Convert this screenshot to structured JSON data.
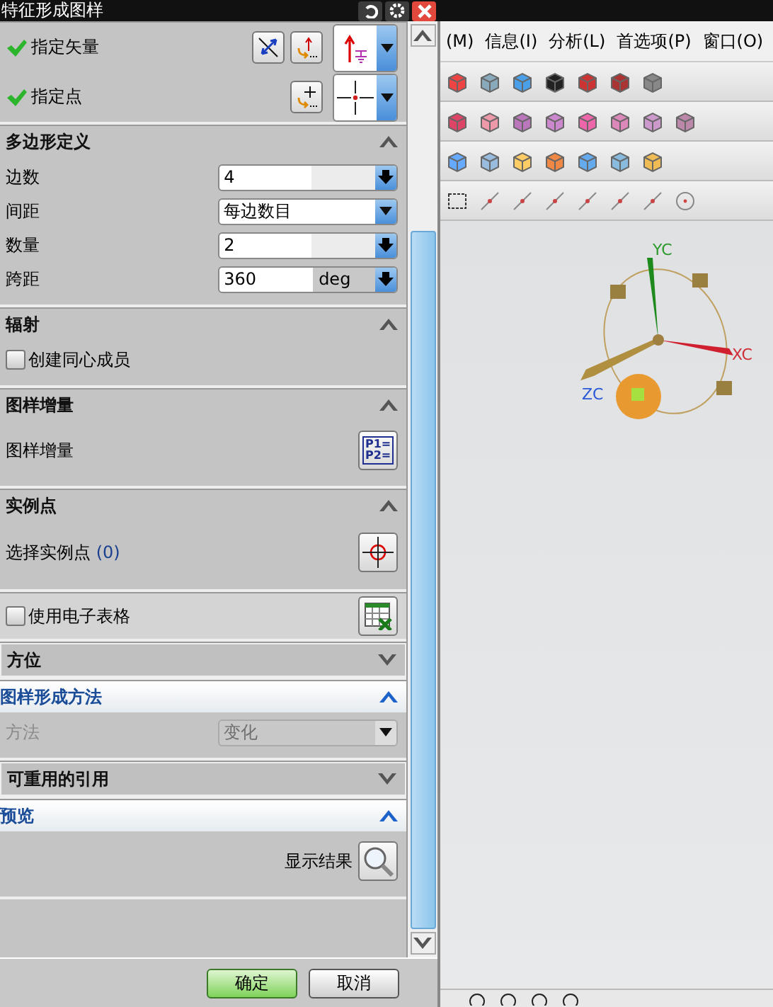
{
  "title_bar": {
    "title": "特征形成图样"
  },
  "menu_bar": {
    "items": [
      "(M)",
      "信息(I)",
      "分析(L)",
      "首选项(P)",
      "窗口(O)"
    ]
  },
  "dialog": {
    "sections": [
      {
        "rows": [
          {
            "kind": "vector",
            "label": "指定矢量",
            "complete": true
          },
          {
            "kind": "point",
            "label": "指定点",
            "complete": true
          }
        ]
      },
      {
        "title": "多边形定义",
        "expanded": true,
        "highlighted": false,
        "rows": [
          {
            "kind": "spin",
            "label": "边数",
            "value": "4"
          },
          {
            "kind": "dropdown",
            "label": "间距",
            "value": "每边数目",
            "disabled": false
          },
          {
            "kind": "spin",
            "label": "数量",
            "value": "2"
          },
          {
            "kind": "spin",
            "label": "跨距",
            "value": "360",
            "unit": "deg"
          }
        ]
      },
      {
        "title": "辐射",
        "expanded": true,
        "highlighted": false,
        "rows": [
          {
            "kind": "checkbox",
            "label": "创建同心成员",
            "checked": false
          }
        ]
      },
      {
        "title": "图样增量",
        "expanded": true,
        "highlighted": false,
        "rows": [
          {
            "kind": "increment",
            "label": "图样增量",
            "icon_text": [
              "P1=",
              "P2="
            ]
          }
        ]
      },
      {
        "title": "实例点",
        "expanded": true,
        "highlighted": false,
        "rows": [
          {
            "kind": "select",
            "label": "选择实例点",
            "count": "(0)"
          }
        ]
      },
      {
        "rows": [
          {
            "kind": "spreadsheet",
            "label": "使用电子表格",
            "checked": false
          }
        ]
      },
      {
        "title": "方位",
        "expanded": false,
        "highlighted": false
      },
      {
        "title": "图样形成方法",
        "expanded": true,
        "highlighted": true,
        "rows": [
          {
            "kind": "dropdown",
            "label": "方法",
            "value": "变化",
            "disabled": true
          }
        ]
      },
      {
        "title": "可重用的引用",
        "expanded": false,
        "highlighted": false
      },
      {
        "title": "预览",
        "expanded": true,
        "highlighted": true,
        "rows": [
          {
            "kind": "preview",
            "label": "显示结果"
          }
        ]
      }
    ]
  },
  "viewport": {
    "axis_labels": [
      {
        "label": "YC",
        "color": "#2e9a2e"
      },
      {
        "label": "XC",
        "color": "#d0303a"
      },
      {
        "label": "ZC",
        "color": "#2a5ad8"
      }
    ]
  },
  "buttons": [
    {
      "label": "确定",
      "kind": "primary"
    },
    {
      "label": "取消",
      "kind": "secondary"
    }
  ]
}
